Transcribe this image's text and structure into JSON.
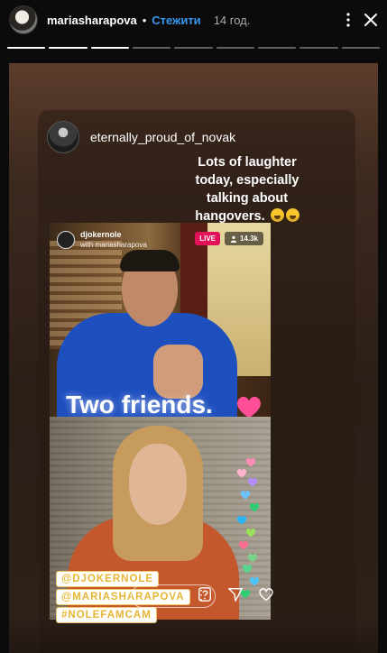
{
  "header": {
    "username": "mariasharapova",
    "separator": "•",
    "follow_label": "Стежити",
    "time_ago": "14 год.",
    "more_icon": "more-vertical-icon",
    "close_icon": "close-icon"
  },
  "progress": {
    "segments": [
      1,
      1,
      1,
      0,
      0,
      0,
      0,
      0,
      0
    ],
    "active_fill": 1
  },
  "repost": {
    "account": "eternally_proud_of_novak",
    "caption_lines": [
      "Lots of laughter",
      "today, especially",
      "talking about",
      "hangovers."
    ],
    "caption_emoji": "grinning-squinting-face"
  },
  "live": {
    "host_name": "djokernole",
    "host_sub": "with mariasharapova",
    "live_label": "LIVE",
    "viewers": "14.3k",
    "overlay_title": "Two friends.",
    "tags": [
      "@DJOKERNOLE",
      "@MARIASHARAPOVA",
      "#NOLEFAMCAM"
    ],
    "comment_more": "⋮"
  },
  "colors": {
    "follow": "#3897f0",
    "live_badge": "#e2125a",
    "tag_text": "#e5b533",
    "heart_pink": "#ff4f9a"
  }
}
